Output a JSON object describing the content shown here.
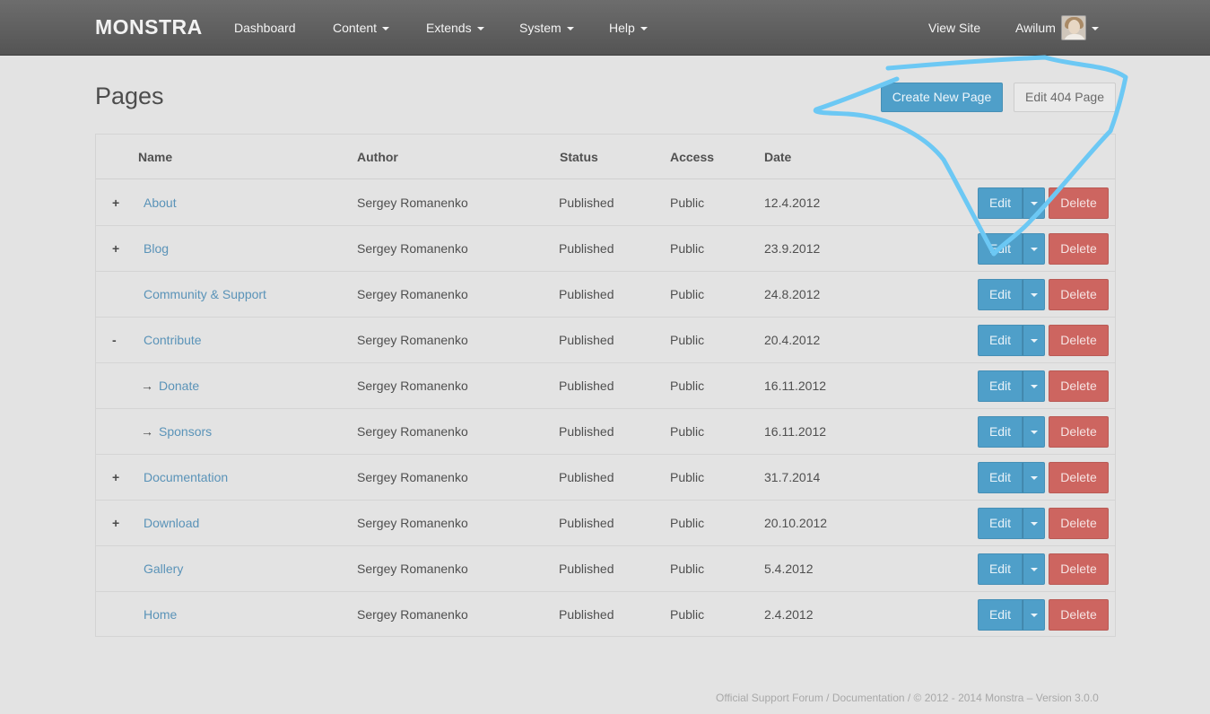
{
  "navbar": {
    "brand": "MONSTRA",
    "items": [
      {
        "label": "Dashboard"
      },
      {
        "label": "Content"
      },
      {
        "label": "Extends"
      },
      {
        "label": "System"
      },
      {
        "label": "Help"
      }
    ],
    "view_site": "View Site",
    "user": "Awilum"
  },
  "page": {
    "title": "Pages",
    "create_button": "Create New Page",
    "edit404_button": "Edit 404 Page"
  },
  "table": {
    "headers": {
      "name": "Name",
      "author": "Author",
      "status": "Status",
      "access": "Access",
      "date": "Date"
    },
    "rows": [
      {
        "toggle": "+",
        "arrow": "",
        "name": "About",
        "author": "Sergey Romanenko",
        "status": "Published",
        "access": "Public",
        "date": "12.4.2012",
        "edit": "Edit",
        "delete": "Delete"
      },
      {
        "toggle": "+",
        "arrow": "",
        "name": "Blog",
        "author": "Sergey Romanenko",
        "status": "Published",
        "access": "Public",
        "date": "23.9.2012",
        "edit": "Edit",
        "delete": "Delete"
      },
      {
        "toggle": "",
        "arrow": "",
        "name": "Community & Support",
        "author": "Sergey Romanenko",
        "status": "Published",
        "access": "Public",
        "date": "24.8.2012",
        "edit": "Edit",
        "delete": "Delete"
      },
      {
        "toggle": "-",
        "arrow": "",
        "name": "Contribute",
        "author": "Sergey Romanenko",
        "status": "Published",
        "access": "Public",
        "date": "20.4.2012",
        "edit": "Edit",
        "delete": "Delete"
      },
      {
        "toggle": "",
        "arrow": "→",
        "name": "Donate",
        "author": "Sergey Romanenko",
        "status": "Published",
        "access": "Public",
        "date": "16.11.2012",
        "edit": "Edit",
        "delete": "Delete"
      },
      {
        "toggle": "",
        "arrow": "→",
        "name": "Sponsors",
        "author": "Sergey Romanenko",
        "status": "Published",
        "access": "Public",
        "date": "16.11.2012",
        "edit": "Edit",
        "delete": "Delete"
      },
      {
        "toggle": "+",
        "arrow": "",
        "name": "Documentation",
        "author": "Sergey Romanenko",
        "status": "Published",
        "access": "Public",
        "date": "31.7.2014",
        "edit": "Edit",
        "delete": "Delete"
      },
      {
        "toggle": "+",
        "arrow": "",
        "name": "Download",
        "author": "Sergey Romanenko",
        "status": "Published",
        "access": "Public",
        "date": "20.10.2012",
        "edit": "Edit",
        "delete": "Delete"
      },
      {
        "toggle": "",
        "arrow": "",
        "name": "Gallery",
        "author": "Sergey Romanenko",
        "status": "Published",
        "access": "Public",
        "date": "5.4.2012",
        "edit": "Edit",
        "delete": "Delete"
      },
      {
        "toggle": "",
        "arrow": "",
        "name": "Home",
        "author": "Sergey Romanenko",
        "status": "Published",
        "access": "Public",
        "date": "2.4.2012",
        "edit": "Edit",
        "delete": "Delete"
      }
    ]
  },
  "footer": {
    "text": "Official Support Forum / Documentation / © 2012 - 2014 Monstra – Version 3.0.0"
  },
  "colors": {
    "navbar": "#5f5f5f",
    "primary_button": "#4f9fc9",
    "danger_button": "#cd6560",
    "link": "#5a93b8",
    "annotation_stroke": "#6cc8f4"
  }
}
